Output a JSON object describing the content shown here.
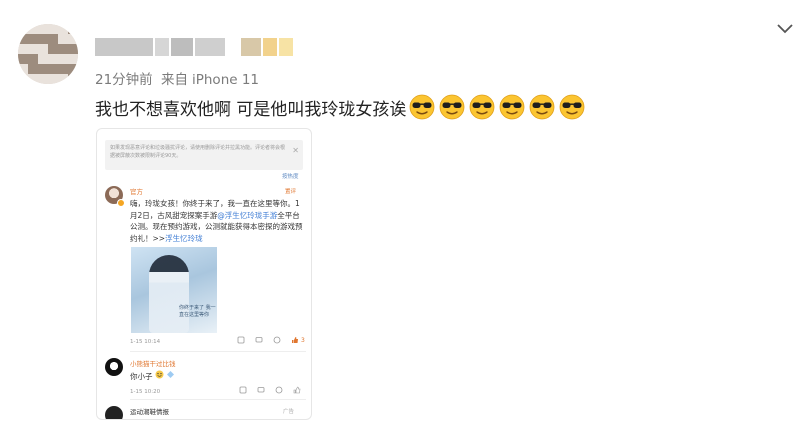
{
  "post": {
    "time": "21分钟前",
    "source_prefix": "来自",
    "source": "iPhone 11",
    "text": "我也不想喜欢他啊 可是他叫我玲珑女孩诶",
    "emoji_count": 6
  },
  "screenshot": {
    "notice": "如果发现恶意评论和垃圾骚扰评论，请使用删除评论并拉黑功能。评论者将会根据被屏蔽次数被限制评论90天。",
    "notice_close": "✕",
    "sort_link": "按热度",
    "comment1": {
      "name": "官方",
      "tag": "置评",
      "text_a": "嗨，玲珑女孩！你终于来了，我一直在这里等你。1月2日，古风甜宠探案手游",
      "link_a": "@浮生忆玲珑手游",
      "text_b": "全平台公测。现在预约游戏，公测就能获得本密探的游戏预约礼！>>",
      "link_b": "浮生忆玲珑",
      "poster_text": "你终于来了 我一直在这里等你",
      "time": "1-15 10:14",
      "likes": "3"
    },
    "comment2": {
      "name": "小熊猫干过比钱",
      "text": "你小子",
      "time": "1-15 10:20"
    },
    "comment3": {
      "name": "运动潮鞋情报",
      "ad": "广告"
    }
  },
  "icons": {
    "chevron": "chevron-down-icon",
    "emoji": "sunglasses-emoji-icon",
    "like": "thumbs-up-icon"
  },
  "colors": {
    "link": "#3e7cd4",
    "accent": "#e0762f",
    "meta": "#7b7b7b"
  }
}
